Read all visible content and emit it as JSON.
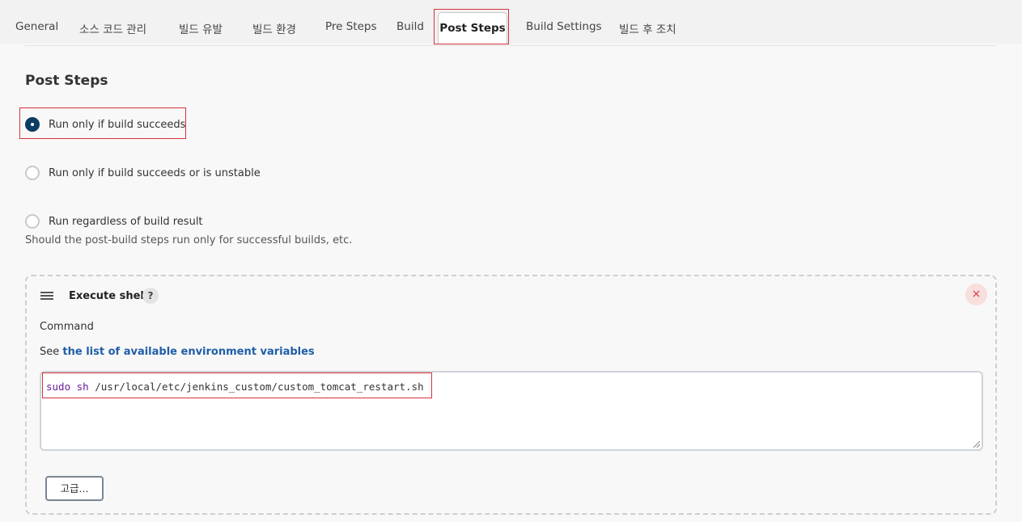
{
  "tabs": [
    {
      "label": "General"
    },
    {
      "label": "소스 코드 관리"
    },
    {
      "label": "빌드 유발"
    },
    {
      "label": "빌드 환경"
    },
    {
      "label": "Pre Steps"
    },
    {
      "label": "Build"
    },
    {
      "label": "Post Steps"
    },
    {
      "label": "Build Settings"
    },
    {
      "label": "빌드 후 조치"
    }
  ],
  "active_tab": "Post Steps",
  "post_steps": {
    "title": "Post Steps",
    "options": [
      {
        "label": "Run only if build succeeds",
        "checked": true
      },
      {
        "label": "Run only if build succeeds or is unstable",
        "checked": false
      },
      {
        "label": "Run regardless of build result",
        "checked": false
      }
    ],
    "help_text": "Should the post-build steps run only for successful builds, etc."
  },
  "execute_shell": {
    "title": "Execute shell",
    "help_icon": "?",
    "close_icon": "×",
    "command_label": "Command",
    "see_prefix": "See ",
    "env_link": "the list of available environment variables",
    "command_keyword": "sudo sh",
    "command_rest": " /usr/local/etc/jenkins_custom/custom_tomcat_restart.sh",
    "advanced_button": "고급..."
  },
  "colors": {
    "accent": "#0b3d62",
    "highlight": "#d6323c",
    "link": "#1f5ea8"
  }
}
